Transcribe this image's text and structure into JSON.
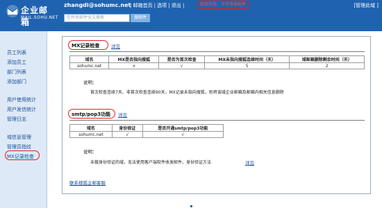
{
  "header": {
    "logo_brand": "企业邮箱",
    "logo_sub": "MAIL.SOHU.NET",
    "email": "zhangdi@sohumc.net",
    "nav": [
      "| 邮箱首页",
      "| 选项",
      "| 退出 |"
    ],
    "alert": "检验失败，不可收发邮件",
    "admin": "[管理此域 ]",
    "search_placeholder": "在所有邮件全文搜索",
    "search_button": "搜邮件"
  },
  "sidebar": {
    "items": [
      "员工列表",
      "添加员工",
      "部门列表",
      "添加部门",
      "用户使用统计",
      "用户发信统计",
      "管理日志",
      "域信息管理",
      "管理员指纹",
      "MX记录检查"
    ]
  },
  "mx_section": {
    "title": "MX记录检查",
    "detail_link": "详见",
    "table": {
      "headers": [
        "域名",
        "MX是否指向搜狐",
        "是否为首次检查",
        "MX未指向搜狐连续时间（天）",
        "域邮箱删除剩余时间（天）"
      ],
      "rows": [
        [
          "sohumc.net",
          "×",
          "√",
          "5",
          "2"
        ]
      ]
    },
    "note_label": "说明：",
    "note": "首次检查连续7天、非首次检查连续90天，MX记录未指向搜狐，则将该域企业邮箱及邮箱内相关信息删除"
  },
  "smtp_section": {
    "title": "smtp/pop3功能",
    "detail_link": "详见",
    "table": {
      "headers": [
        "域名",
        "身份验证",
        "是否开通smtp/pop3功能"
      ],
      "rows": [
        [
          "sohumc.net",
          "√",
          "√"
        ]
      ]
    },
    "note_label": "说明：",
    "note": "未做身份验证的域，无法使用客户端软件收发邮件。身份验证方法",
    "note_link": "详见"
  },
  "footer_link": "联系搜狐企邮客服",
  "colors": {
    "header_bg": "#1f63b0",
    "sidebar_bg": "#dde9f6",
    "highlight": "#e02020",
    "link": "#1a4f9a"
  }
}
